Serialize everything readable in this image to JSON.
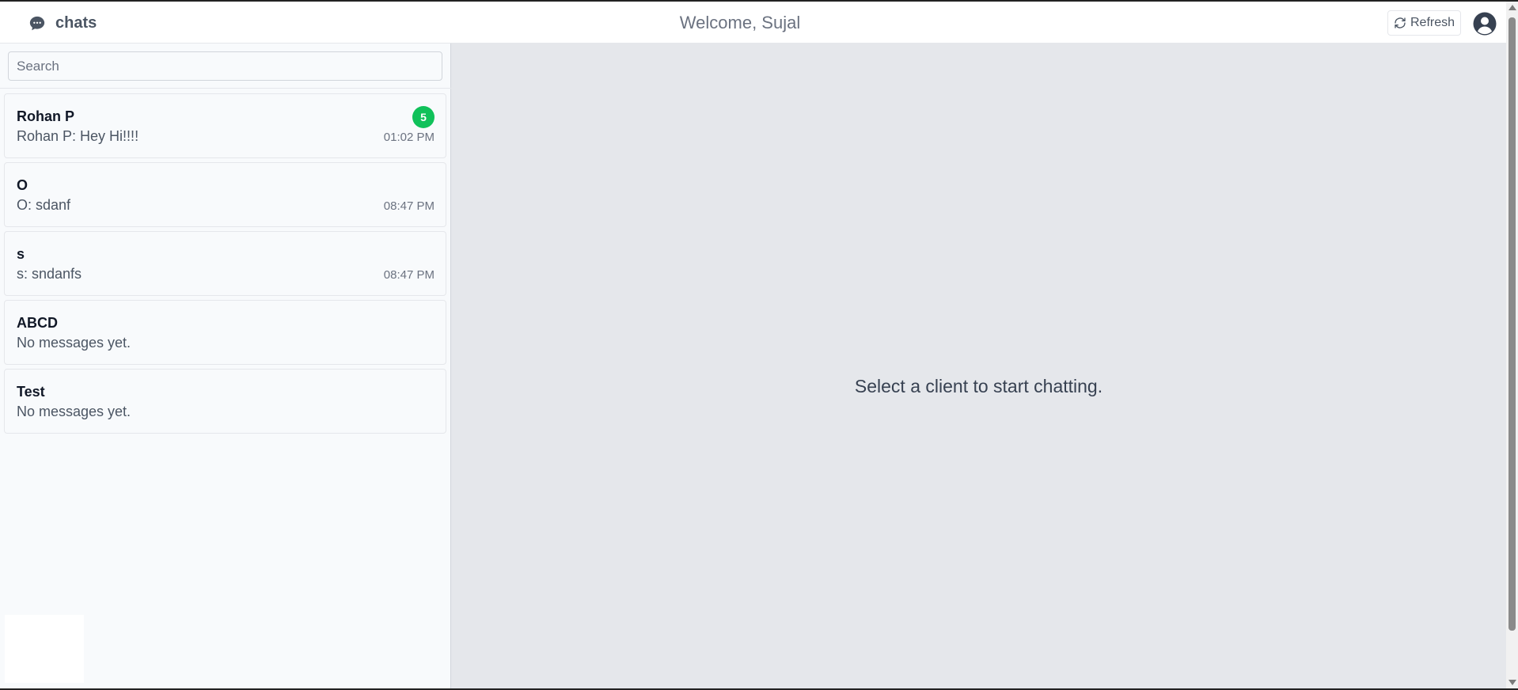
{
  "header": {
    "brand_label": "chats",
    "brand_icon": "chat-bubble-icon",
    "welcome_text": "Welcome, Sujal",
    "refresh_label": "Refresh",
    "refresh_icon": "refresh-icon",
    "avatar_icon": "user-circle-icon"
  },
  "search": {
    "placeholder": "Search",
    "value": ""
  },
  "chats": [
    {
      "name": "Rohan P",
      "preview": "Rohan P: Hey Hi!!!!",
      "time": "01:02 PM",
      "unread": "5"
    },
    {
      "name": "O",
      "preview": "O: sdanf",
      "time": "08:47 PM",
      "unread": ""
    },
    {
      "name": "s",
      "preview": "s: sndanfs",
      "time": "08:47 PM",
      "unread": ""
    },
    {
      "name": "ABCD",
      "preview": "No messages yet.",
      "time": "",
      "unread": ""
    },
    {
      "name": "Test",
      "preview": "No messages yet.",
      "time": "",
      "unread": ""
    }
  ],
  "main": {
    "empty_text": "Select a client to start chatting."
  },
  "colors": {
    "unread_badge": "#10c15a",
    "main_background": "#e5e7eb",
    "sidebar_background": "#f8fafc"
  }
}
